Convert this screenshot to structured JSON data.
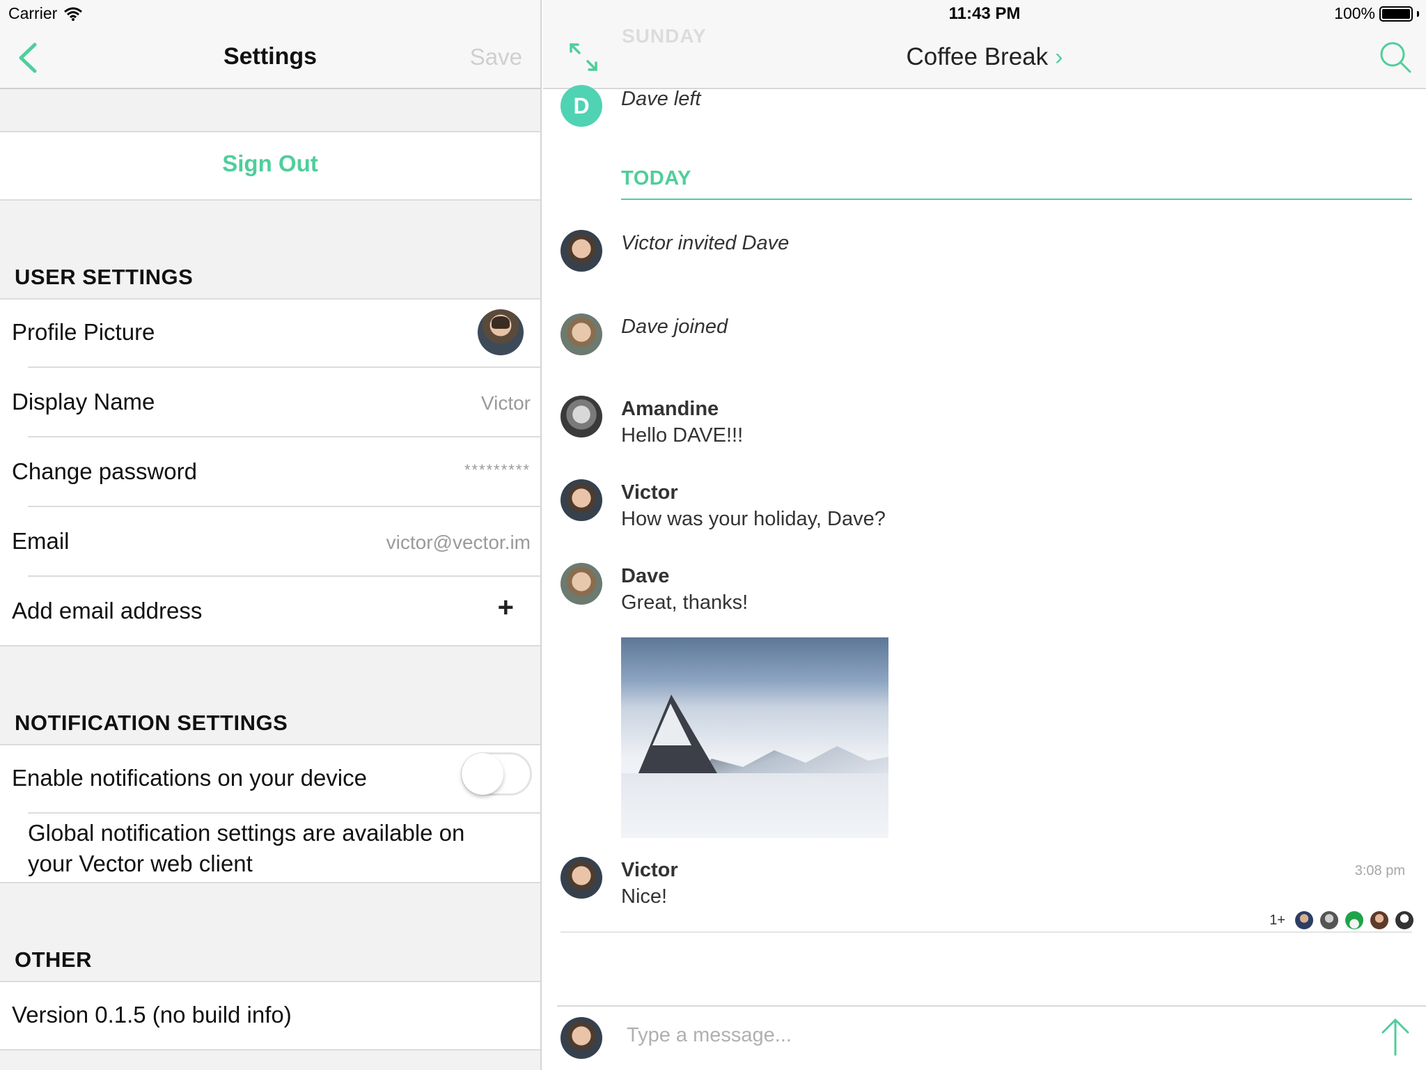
{
  "status": {
    "carrier": "Carrier",
    "time": "11:43 PM",
    "battery": "100%"
  },
  "settings": {
    "title": "Settings",
    "save_label": "Save",
    "sign_out": "Sign Out",
    "user_settings": {
      "header": "USER SETTINGS",
      "profile_picture": "Profile Picture",
      "display_name_label": "Display Name",
      "display_name_value": "Victor",
      "change_password_label": "Change password",
      "change_password_value": "*********",
      "email_label": "Email",
      "email_value": "victor@vector.im",
      "add_email_label": "Add email address",
      "add_email_icon": "+"
    },
    "notification_settings": {
      "header": "NOTIFICATION SETTINGS",
      "enable_label": "Enable notifications on your device",
      "enabled": false,
      "global_note_line1": "Global notification settings are available on",
      "global_note_line2": "your Vector web client"
    },
    "other": {
      "header": "OTHER",
      "version": "Version 0.1.5 (no build info)"
    }
  },
  "room": {
    "name": "Coffee Break",
    "ghost_header": "SUNDAY",
    "accent": "#4fce9b",
    "timeline": {
      "dave_left_avatar": "D",
      "dave_left": "Dave left",
      "today": "TODAY",
      "victor_invited": "Victor invited Dave",
      "dave_joined": "Dave joined",
      "amandine_name": "Amandine",
      "amandine_msg": "Hello DAVE!!!",
      "victor_name": "Victor",
      "victor_msg": "How was your holiday, Dave?",
      "dave_name": "Dave",
      "dave_msg": "Great, thanks!",
      "victor_name_2": "Victor",
      "victor_msg_2": "Nice!",
      "victor_msg_2_time": "3:08 pm",
      "read_receipts_more": "1+"
    },
    "composer": {
      "placeholder": "Type a message..."
    }
  }
}
